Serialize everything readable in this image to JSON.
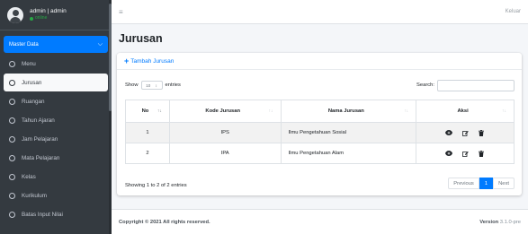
{
  "user": {
    "name": "admin | admin",
    "status": "online"
  },
  "sidebar": {
    "header": "Master Data",
    "items": [
      {
        "label": "Menu"
      },
      {
        "label": "Jurusan",
        "active": true
      },
      {
        "label": "Ruangan"
      },
      {
        "label": "Tahun Ajaran"
      },
      {
        "label": "Jam Pelajaran"
      },
      {
        "label": "Mata Pelajaran"
      },
      {
        "label": "Kelas"
      },
      {
        "label": "Kurikulum"
      },
      {
        "label": "Batas Input Nilai"
      }
    ]
  },
  "topbar": {
    "logout": "Keluar"
  },
  "page": {
    "title": "Jurusan"
  },
  "card": {
    "add_label": "Tambah Jurusan"
  },
  "controls": {
    "show": "Show",
    "length_value": "10",
    "entries": "entries",
    "search_label": "Search:"
  },
  "table": {
    "headers": [
      "No",
      "Kode Jurusan",
      "Nama Jurusan",
      "Aksi"
    ],
    "rows": [
      {
        "no": "1",
        "kode": "IPS",
        "nama": "Ilmu Pengetahuan Sosial"
      },
      {
        "no": "2",
        "kode": "IPA",
        "nama": "Ilmu Pengetahuan Alam"
      }
    ]
  },
  "info": "Showing 1 to 2 of 2 entries",
  "pagination": {
    "previous": "Previous",
    "current": "1",
    "next": "Next"
  },
  "footer": {
    "copyright": "Copyright © 2021 All rights reserved.",
    "version_label": "Version",
    "version_value": "3.1.0-pre"
  },
  "colors": {
    "sidebar": "#343a40",
    "primary": "#007bff",
    "online": "#28a745"
  },
  "icons": [
    "user-avatar-icon",
    "hamburger-icon",
    "plus-icon",
    "chevron-down-icon",
    "circle-icon",
    "eye-icon",
    "edit-icon",
    "trash-icon"
  ]
}
